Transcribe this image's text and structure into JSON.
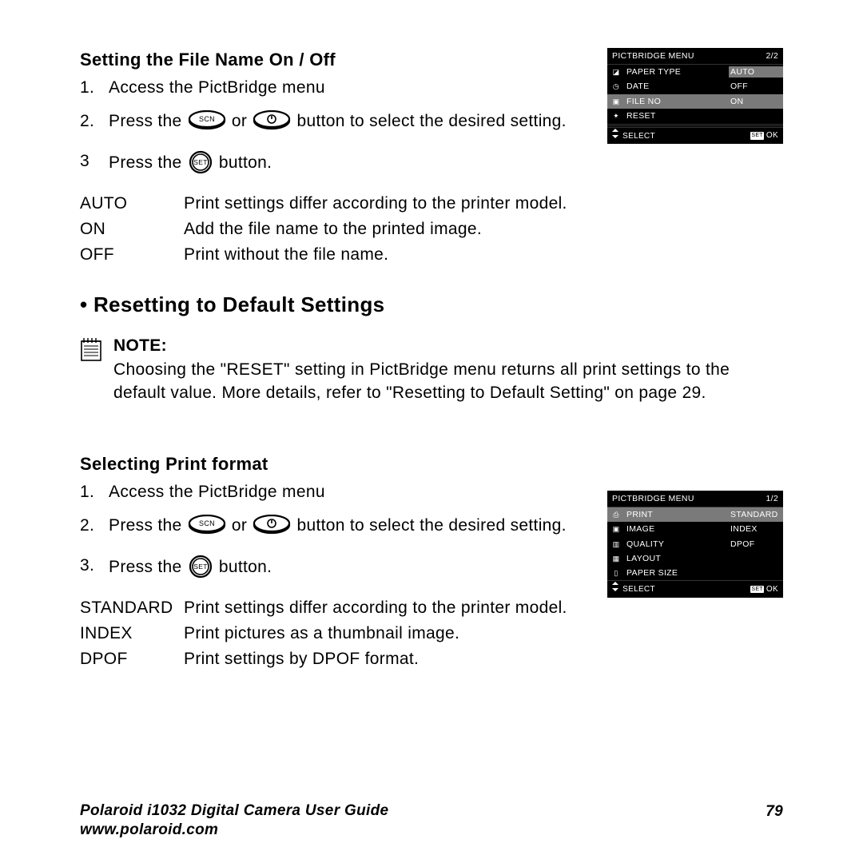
{
  "section1": {
    "title": "Setting the File Name On / Off",
    "steps": [
      {
        "num": "1.",
        "pre": "Access the PictBridge menu",
        "mid": "",
        "post": ""
      },
      {
        "num": "2.",
        "pre": "Press the ",
        "mid": " or ",
        "post": " button to select the desired setting."
      },
      {
        "num": "3",
        "pre": "Press the ",
        "mid": "",
        "post": " button."
      }
    ],
    "defs": [
      {
        "term": "AUTO",
        "desc": "Print settings differ according to the printer model."
      },
      {
        "term": "ON",
        "desc": "Add the file name to the printed image."
      },
      {
        "term": "OFF",
        "desc": "Print without the file name."
      }
    ]
  },
  "reset": {
    "title": "• Resetting to Default Settings",
    "note_label": "NOTE:",
    "note_text": "Choosing the \"RESET\" setting in PictBridge menu returns all print settings to the default value. More details, refer to \"Resetting to Default Setting\" on page 29."
  },
  "section2": {
    "title": "Selecting Print format",
    "steps": [
      {
        "num": "1.",
        "pre": "Access the PictBridge menu",
        "mid": "",
        "post": ""
      },
      {
        "num": "2.",
        "pre": "Press the ",
        "mid": " or ",
        "post": " button to select the desired setting."
      },
      {
        "num": "3.",
        "pre": "Press the ",
        "mid": "",
        "post": " button."
      }
    ],
    "defs": [
      {
        "term": "STANDARD",
        "desc": "Print settings differ according to the printer model."
      },
      {
        "term": "INDEX",
        "desc": "Print pictures as a thumbnail image."
      },
      {
        "term": "DPOF",
        "desc": "Print settings by DPOF format."
      }
    ]
  },
  "lcd1": {
    "title": "PICTBRIDGE MENU",
    "page": "2/2",
    "rows": [
      {
        "label": "PAPER TYPE",
        "value": "AUTO",
        "sel_row": false,
        "sel_val": true
      },
      {
        "label": "DATE",
        "value": "OFF",
        "sel_row": false,
        "sel_val": false
      },
      {
        "label": "FILE NO",
        "value": "ON",
        "sel_row": true,
        "sel_val": false
      },
      {
        "label": "RESET",
        "value": "",
        "sel_row": false,
        "sel_val": false
      }
    ],
    "footer_left": "SELECT",
    "footer_right": "OK",
    "footer_badge": "SET"
  },
  "lcd2": {
    "title": "PICTBRIDGE MENU",
    "page": "1/2",
    "rows": [
      {
        "label": "PRINT",
        "value": "STANDARD",
        "sel_row": true,
        "sel_val": true
      },
      {
        "label": "IMAGE",
        "value": "INDEX",
        "sel_row": false,
        "sel_val": false
      },
      {
        "label": "QUALITY",
        "value": "DPOF",
        "sel_row": false,
        "sel_val": false
      },
      {
        "label": "LAYOUT",
        "value": "",
        "sel_row": false,
        "sel_val": false
      },
      {
        "label": "PAPER SIZE",
        "value": "",
        "sel_row": false,
        "sel_val": false
      }
    ],
    "footer_left": "SELECT",
    "footer_right": "OK",
    "footer_badge": "SET"
  },
  "footer": {
    "guide": "Polaroid i1032 Digital Camera User Guide",
    "url": "www.polaroid.com",
    "page": "79"
  }
}
